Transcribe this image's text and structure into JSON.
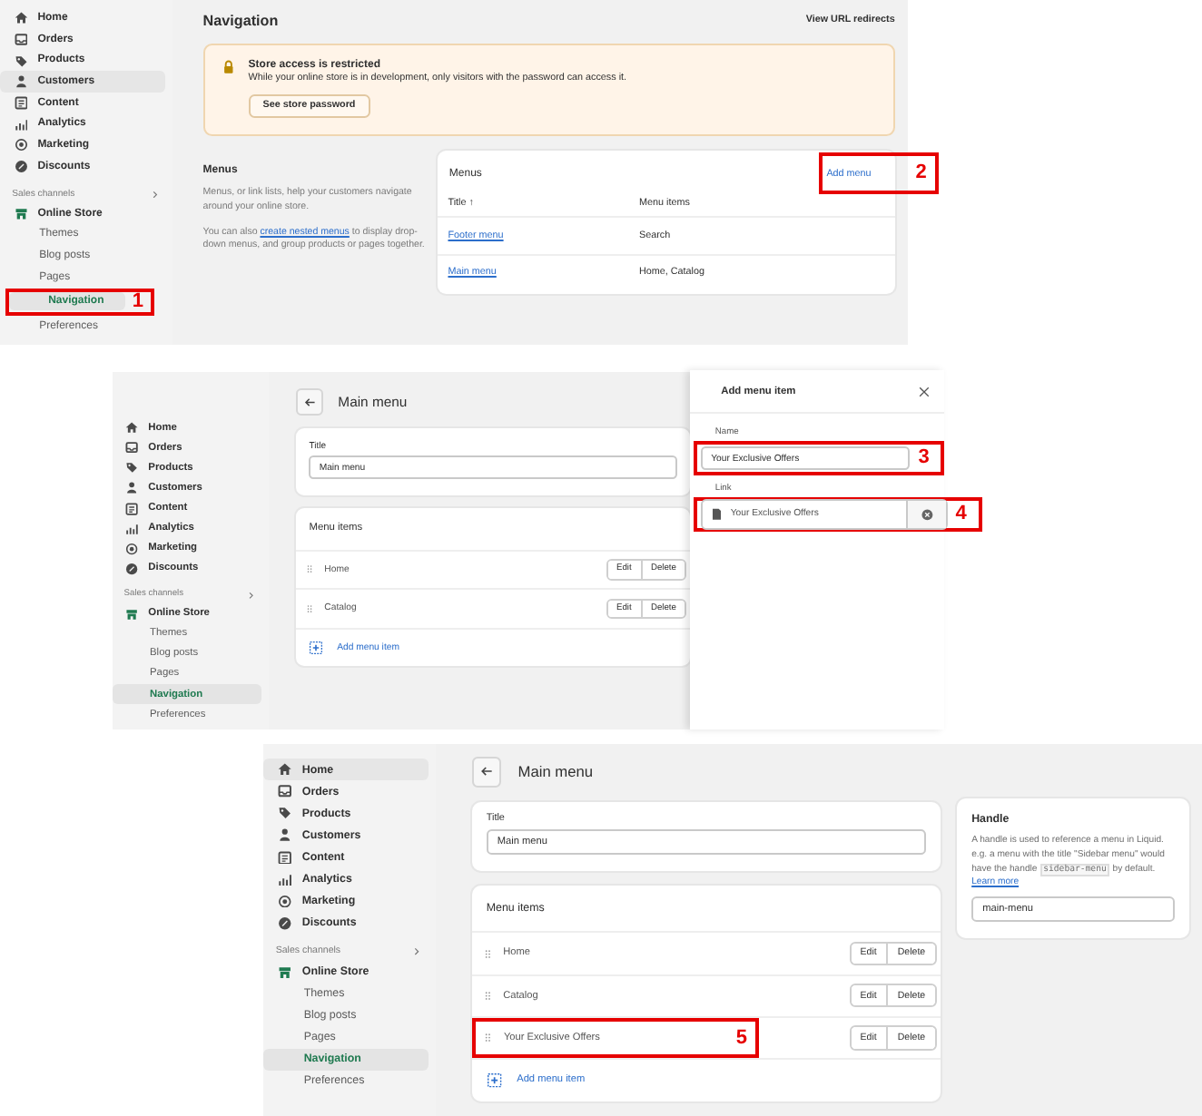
{
  "panels": [
    {
      "kind": "navigation",
      "sidebar": {
        "items": [
          {
            "label": "Home",
            "highlighted": false
          },
          {
            "label": "Orders",
            "highlighted": false
          },
          {
            "label": "Products",
            "highlighted": false
          },
          {
            "label": "Customers",
            "highlighted": true
          },
          {
            "label": "Content",
            "highlighted": false
          },
          {
            "label": "Analytics",
            "highlighted": false
          },
          {
            "label": "Marketing",
            "highlighted": false
          },
          {
            "label": "Discounts",
            "highlighted": false
          }
        ],
        "section_label": "Sales channels",
        "channel": "Online Store",
        "sub_items": [
          {
            "label": "Themes",
            "selected": false
          },
          {
            "label": "Blog posts",
            "selected": false
          },
          {
            "label": "Pages",
            "selected": false
          },
          {
            "label": "Navigation",
            "selected": true,
            "callout": "1"
          },
          {
            "label": "Preferences",
            "selected": false
          }
        ]
      },
      "title": "Navigation",
      "header_link": "View URL redirects",
      "banner": {
        "title": "Store access is restricted",
        "text": "While your online store is in development, only visitors with the password can access it.",
        "button": "See store password"
      },
      "menus_section": {
        "heading": "Menus",
        "description": "Menus, or link lists, help your customers navigate around your online store.",
        "note": {
          "before": "You can also",
          "link": "create nested menus",
          "after": "to display drop-down menus, and group products or pages together."
        }
      },
      "menus_card": {
        "heading": "Menus",
        "action": {
          "label": "Add menu",
          "callout": "2"
        },
        "columns": [
          "Title ↑",
          "Menu items"
        ],
        "rows": [
          {
            "title": "Footer menu",
            "items": "Search"
          },
          {
            "title": "Main menu",
            "items": "Home, Catalog"
          }
        ]
      }
    },
    {
      "kind": "menu_editor",
      "sidebar": {
        "items": [
          {
            "label": "Home",
            "highlighted": false
          },
          {
            "label": "Orders",
            "highlighted": false
          },
          {
            "label": "Products",
            "highlighted": false
          },
          {
            "label": "Customers",
            "highlighted": false
          },
          {
            "label": "Content",
            "highlighted": false
          },
          {
            "label": "Analytics",
            "highlighted": false
          },
          {
            "label": "Marketing",
            "highlighted": false
          },
          {
            "label": "Discounts",
            "highlighted": false
          }
        ],
        "section_label": "Sales channels",
        "channel": "Online Store",
        "sub_items": [
          {
            "label": "Themes",
            "selected": false
          },
          {
            "label": "Blog posts",
            "selected": false
          },
          {
            "label": "Pages",
            "selected": false
          },
          {
            "label": "Navigation",
            "selected": true
          },
          {
            "label": "Preferences",
            "selected": false
          }
        ]
      },
      "title": "Main menu",
      "title_field": {
        "label": "Title",
        "value": "Main menu"
      },
      "menu_items": {
        "heading": "Menu items",
        "rows": [
          {
            "label": "Home",
            "edit": "Edit",
            "delete": "Delete"
          },
          {
            "label": "Catalog",
            "edit": "Edit",
            "delete": "Delete"
          }
        ],
        "add": "Add menu item"
      },
      "drawer": {
        "title": "Add menu item",
        "name_field": {
          "label": "Name",
          "value": "Your Exclusive Offers",
          "callout": "3"
        },
        "link_field": {
          "label": "Link",
          "value": "Your Exclusive Offers",
          "callout": "4"
        }
      }
    },
    {
      "kind": "menu_editor",
      "sidebar": {
        "items": [
          {
            "label": "Home",
            "highlighted": true
          },
          {
            "label": "Orders",
            "highlighted": false
          },
          {
            "label": "Products",
            "highlighted": false
          },
          {
            "label": "Customers",
            "highlighted": false
          },
          {
            "label": "Content",
            "highlighted": false
          },
          {
            "label": "Analytics",
            "highlighted": false
          },
          {
            "label": "Marketing",
            "highlighted": false
          },
          {
            "label": "Discounts",
            "highlighted": false
          }
        ],
        "section_label": "Sales channels",
        "channel": "Online Store",
        "sub_items": [
          {
            "label": "Themes",
            "selected": false
          },
          {
            "label": "Blog posts",
            "selected": false
          },
          {
            "label": "Pages",
            "selected": false
          },
          {
            "label": "Navigation",
            "selected": true
          },
          {
            "label": "Preferences",
            "selected": false
          }
        ]
      },
      "title": "Main menu",
      "title_field": {
        "label": "Title",
        "value": "Main menu"
      },
      "menu_items": {
        "heading": "Menu items",
        "rows": [
          {
            "label": "Home",
            "edit": "Edit",
            "delete": "Delete"
          },
          {
            "label": "Catalog",
            "edit": "Edit",
            "delete": "Delete"
          },
          {
            "label": "Your Exclusive Offers",
            "edit": "Edit",
            "delete": "Delete",
            "callout": "5"
          }
        ],
        "add": "Add menu item"
      },
      "handle": {
        "heading": "Handle",
        "text": {
          "before": "A handle is used to reference a menu in Liquid. e.g. a menu with the title \"Sidebar menu\" would have the handle",
          "code": "sidebar-menu",
          "after": "by default.",
          "link": "Learn more"
        },
        "value": "main-menu"
      }
    }
  ]
}
